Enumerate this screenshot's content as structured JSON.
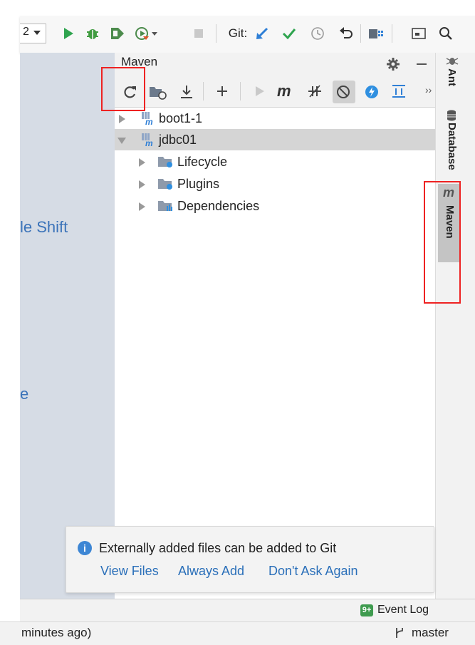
{
  "toolbar": {
    "config_value": "2",
    "git_label": "Git:",
    "icons": [
      "run-icon",
      "debug-icon",
      "coverage-icon",
      "profile-icon",
      "stop-icon",
      "git-update-icon",
      "git-commit-icon",
      "history-icon",
      "revert-icon",
      "project-structure-icon",
      "presentation-icon",
      "search-icon"
    ]
  },
  "editor": {
    "hint_text": "le Shift",
    "hint_text2": "e"
  },
  "maven": {
    "title": "Maven",
    "icons": [
      "reload-icon",
      "generate-sources-icon",
      "download-icon",
      "add-icon",
      "execute-icon",
      "maven-goal-icon",
      "skip-tests-icon",
      "offline-icon",
      "threads-icon",
      "collapse-all-icon",
      "more-icon",
      "gear-icon",
      "minimize-icon"
    ],
    "tree": [
      {
        "label": "boot1-1",
        "level": 0,
        "expanded": false,
        "selected": false
      },
      {
        "label": "jdbc01",
        "level": 0,
        "expanded": true,
        "selected": true
      },
      {
        "label": "Lifecycle",
        "level": 1,
        "expanded": false,
        "selected": false
      },
      {
        "label": "Plugins",
        "level": 1,
        "expanded": false,
        "selected": false
      },
      {
        "label": "Dependencies",
        "level": 1,
        "expanded": false,
        "selected": false
      }
    ]
  },
  "side_tabs": {
    "ant": "Ant",
    "database": "Database",
    "maven": "Maven"
  },
  "notification": {
    "message": "Externally added files can be added to Git",
    "actions": [
      "View Files",
      "Always Add",
      "Don't Ask Again"
    ]
  },
  "status": {
    "event_log_badge": "9+",
    "event_log": "Event Log",
    "left_text": "minutes ago)",
    "branch": "master"
  },
  "colors": {
    "accent_link": "#2a6fb9",
    "highlight_box": "#ee2222",
    "editor_bg": "#d6dce5"
  }
}
